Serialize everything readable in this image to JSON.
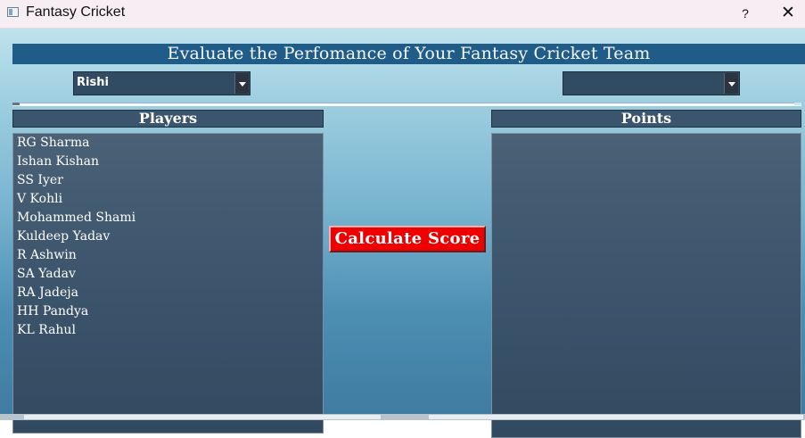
{
  "window": {
    "title": "Fantasy Cricket",
    "help_label": "?",
    "close_label": "✕",
    "icon": "app-window-icon"
  },
  "headline": "Evaluate the Perfomance of Your Fantasy Cricket Team",
  "team_select": {
    "selected": "Rishi",
    "arrow": "chevron-down-icon"
  },
  "match_select": {
    "selected": "",
    "arrow": "chevron-down-icon"
  },
  "players_panel": {
    "title": "Players",
    "items": [
      "RG Sharma",
      "Ishan Kishan",
      "SS Iyer",
      "V Kohli",
      "Mohammed Shami",
      "Kuldeep Yadav",
      "R Ashwin",
      "SA Yadav",
      "RA Jadeja",
      "HH Pandya",
      "KL Rahul"
    ]
  },
  "points_panel": {
    "title": "Points",
    "items": []
  },
  "calculate_button": "Calculate Score",
  "colors": {
    "header_bar": "#1f5d88",
    "panel_bg": "#3d566d",
    "button_red": "#ee0000"
  }
}
